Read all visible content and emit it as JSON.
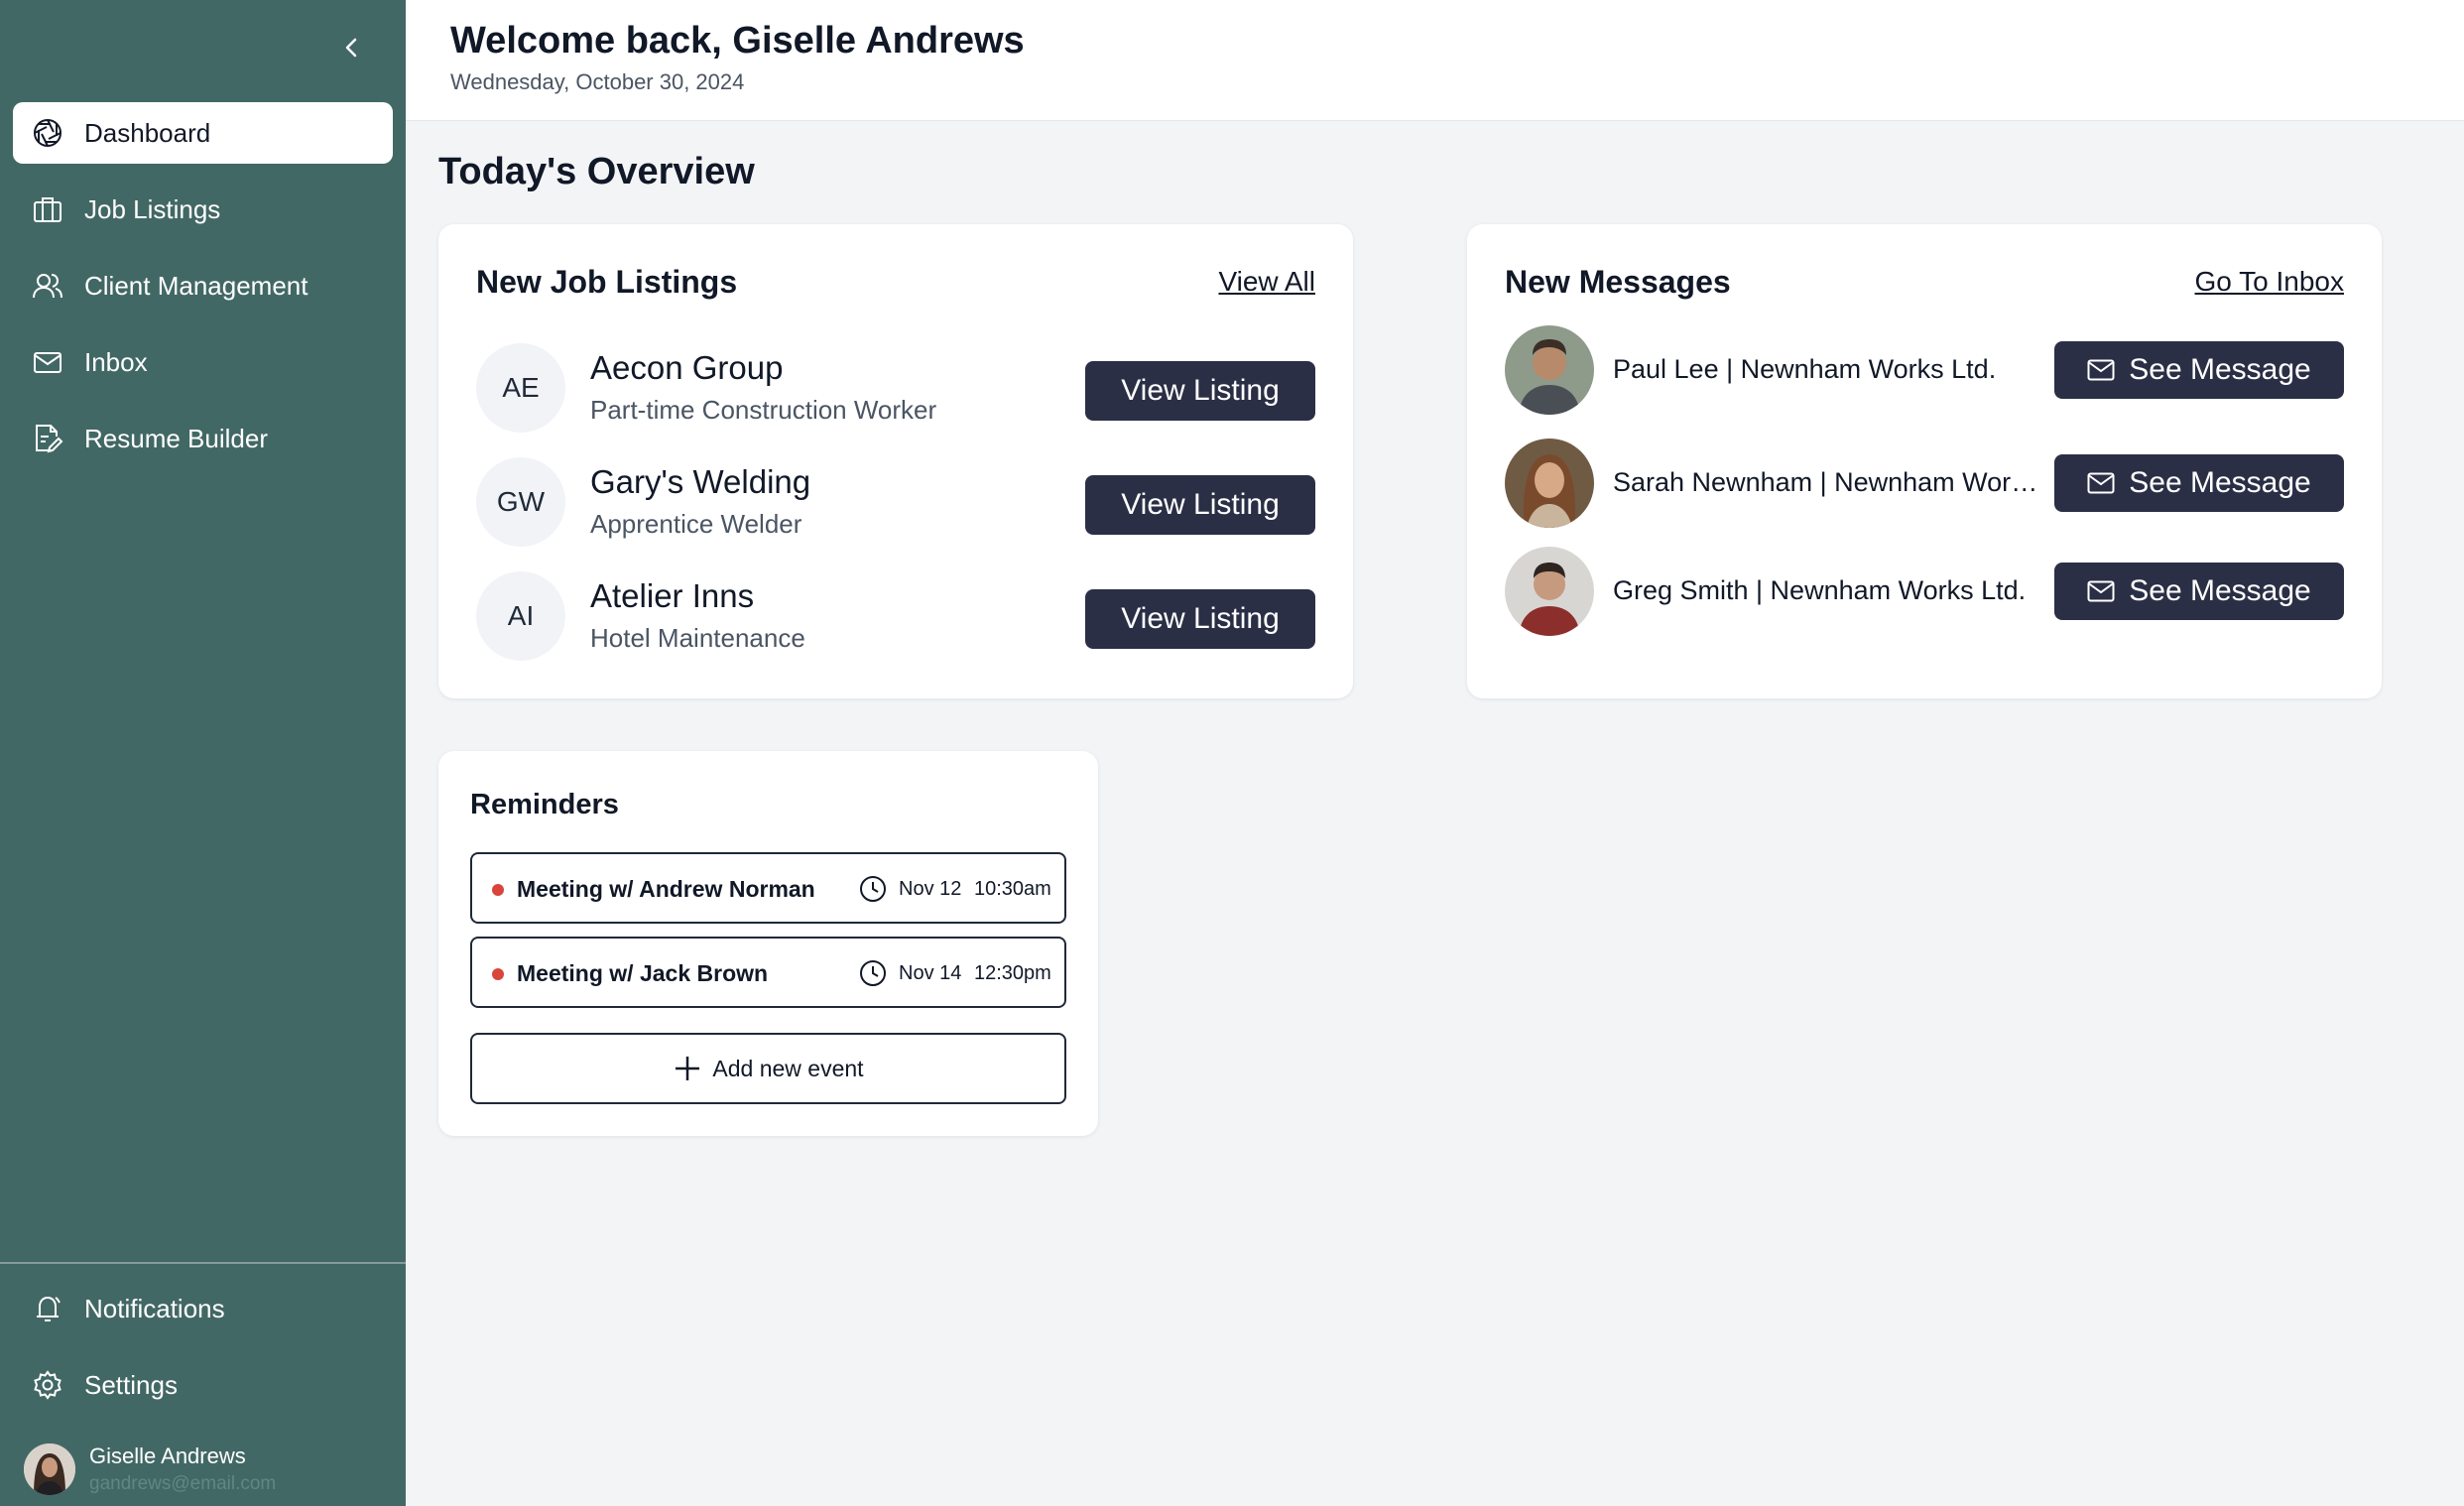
{
  "sidebar": {
    "items": [
      {
        "label": "Dashboard",
        "icon": "aperture-icon"
      },
      {
        "label": "Job Listings",
        "icon": "briefcase-icon"
      },
      {
        "label": "Client Management",
        "icon": "users-icon"
      },
      {
        "label": "Inbox",
        "icon": "mail-icon"
      },
      {
        "label": "Resume Builder",
        "icon": "document-edit-icon"
      }
    ],
    "bottom_items": [
      {
        "label": "Notifications",
        "icon": "bell-icon"
      },
      {
        "label": "Settings",
        "icon": "gear-icon"
      }
    ],
    "user": {
      "name": "Giselle Andrews",
      "email": "gandrews@email.com"
    },
    "colors": {
      "background": "#426865",
      "active": "#ffffff"
    }
  },
  "header": {
    "title": "Welcome back, Giselle Andrews",
    "date": "Wednesday, October 30, 2024"
  },
  "main": {
    "section_title": "Today's Overview",
    "jobs": {
      "title": "New Job Listings",
      "link": "View All",
      "button_label": "View Listing",
      "rows": [
        {
          "initials": "AE",
          "company": "Aecon Group",
          "role": "Part-time Construction Worker"
        },
        {
          "initials": "GW",
          "company": "Gary's Welding",
          "role": "Apprentice Welder"
        },
        {
          "initials": "AI",
          "company": "Atelier Inns",
          "role": "Hotel Maintenance"
        }
      ]
    },
    "messages": {
      "title": "New Messages",
      "link": "Go To Inbox",
      "button_label": "See Message",
      "rows": [
        {
          "sender": "Paul Lee | Newnham Works Ltd."
        },
        {
          "sender": "Sarah Newnham | Newnham Works Ltd."
        },
        {
          "sender": "Greg Smith | Newnham Works Ltd."
        }
      ]
    },
    "reminders": {
      "title": "Reminders",
      "items": [
        {
          "label": "Meeting w/ Andrew Norman",
          "day": "Nov 12",
          "time": "10:30am"
        },
        {
          "label": "Meeting w/ Jack Brown",
          "day": "Nov 14",
          "time": "12:30pm"
        }
      ],
      "add_label": "Add new event"
    },
    "colors": {
      "button": "#2b2f45",
      "reminder_dot": "#d9453b"
    }
  }
}
